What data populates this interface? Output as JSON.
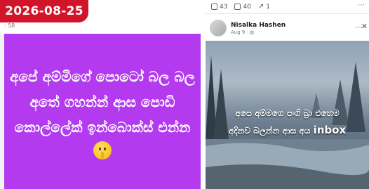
{
  "date_badge": "2026-08-25",
  "left_post": {
    "top_meta": "· 58",
    "lines": [
      "අපේ අම්මිගේ පොටෝ බල බල",
      "අතේ ගහන්න් ආස පොඩි",
      "කොල්ලේක් ඉන්බොක්ස් එන්න"
    ],
    "background_color": "#b43aef",
    "emoji_icon": "shushing-face-emoji"
  },
  "right_post": {
    "reactions": {
      "likes": "43",
      "comments": "40",
      "shares": "1"
    },
    "author": "Nisalka Hashen",
    "date": "Aug 9 ·",
    "image_text": {
      "line1": "අපෙ අම්මගෙ පංගි බ්‍රා එහෙම",
      "line2_prefix": "අදිනව බලන්න ආස අය",
      "line2_en": "inbox"
    }
  }
}
